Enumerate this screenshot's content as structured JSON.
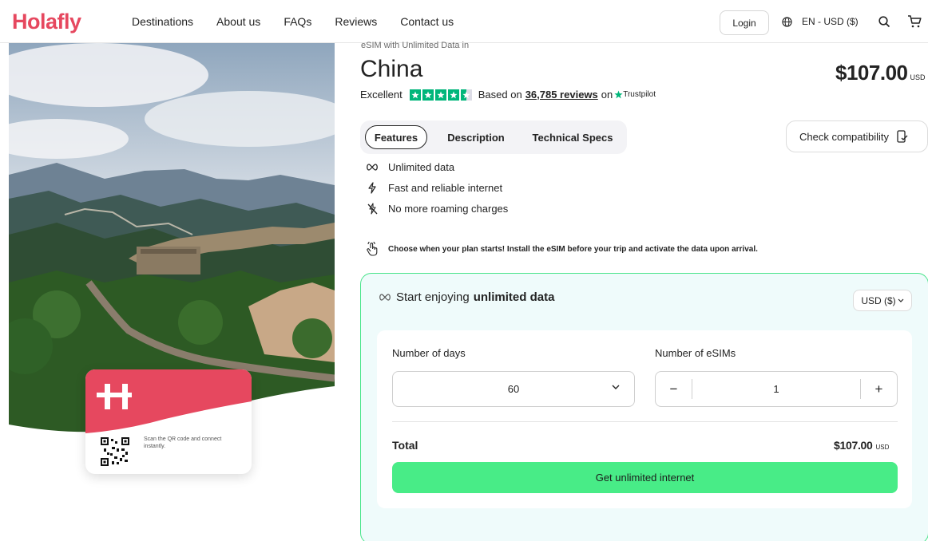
{
  "header": {
    "logo": "Holafly",
    "nav": [
      "Destinations",
      "About us",
      "FAQs",
      "Reviews",
      "Contact us"
    ],
    "login_label": "Login",
    "language": "EN - USD ($)"
  },
  "card": {
    "scan_text": "Scan the QR code and connect instantly."
  },
  "product": {
    "subtitle": "eSIM with Unlimited Data in",
    "title": "China",
    "price": "$107.00",
    "price_currency": "USD",
    "rating_label": "Excellent",
    "rating_stars": 4.5,
    "based_on": "Based on",
    "reviews_count": "36,785 reviews",
    "on": "on",
    "trustpilot": "Trustpilot"
  },
  "tabs": [
    "Features",
    "Description",
    "Technical Specs"
  ],
  "check_compatibility": "Check compatibility",
  "features": [
    {
      "icon": "infinity-icon",
      "label": "Unlimited data"
    },
    {
      "icon": "lightning-icon",
      "label": "Fast and reliable internet"
    },
    {
      "icon": "no-roaming-icon",
      "label": "No more roaming charges"
    }
  ],
  "notice": "Choose when your plan starts! Install the eSIM before your trip and activate the data upon arrival.",
  "plan": {
    "heading_prefix": "Start enjoying",
    "heading_bold": "unlimited data",
    "currency_select": "USD ($)",
    "days_label": "Number of days",
    "days_value": "60",
    "esims_label": "Number of eSIMs",
    "esims_value": "1",
    "minus": "−",
    "plus": "+",
    "total_label": "Total",
    "total_value": "$107.00",
    "total_currency": "USD",
    "cta": "Get unlimited internet"
  },
  "colors": {
    "brand": "#e6485f",
    "cta": "#48ec87",
    "trustpilot": "#00b67a",
    "plan_bg": "#effbfb"
  }
}
